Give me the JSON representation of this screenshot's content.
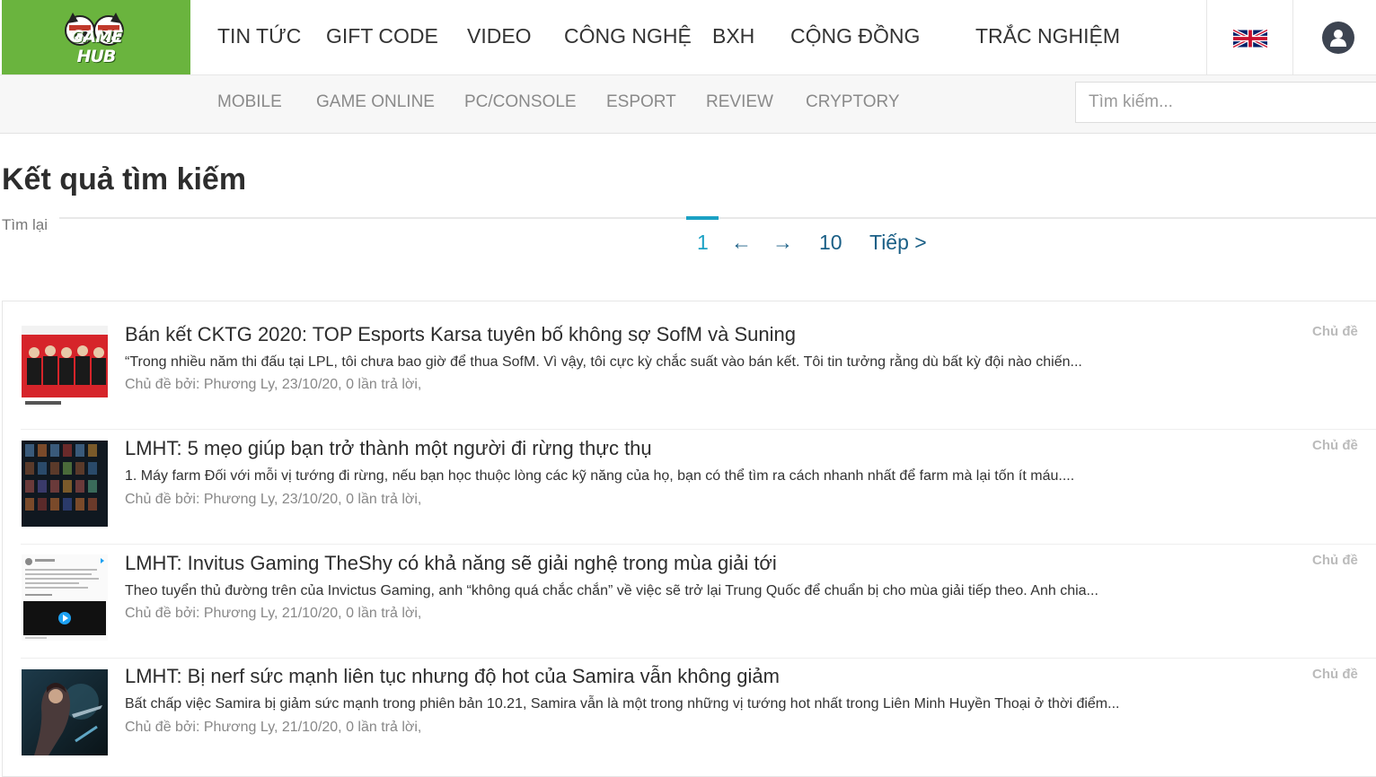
{
  "site": {
    "logo_text": "GAME HUB",
    "main_nav": [
      "TIN TỨC",
      "GIFT CODE",
      "VIDEO",
      "CÔNG NGHỆ",
      "BXH",
      "CỘNG ĐỒNG",
      "TRẮC NGHIỆM"
    ],
    "sub_nav": [
      "MOBILE",
      "GAME ONLINE",
      "PC/CONSOLE",
      "ESPORT",
      "REVIEW",
      "CRYPTORY"
    ],
    "search_placeholder": "Tìm kiếm...",
    "language_icon": "uk-flag-icon",
    "user_icon": "user-icon",
    "brand_color": "#6ab43e",
    "accent_color": "#1ba1c4"
  },
  "page": {
    "title": "Kết quả tìm kiếm",
    "retry_link": "Tìm lại"
  },
  "pagination": {
    "current": "1",
    "prev": "←",
    "next": "→",
    "last": "10",
    "next_label": "Tiếp >"
  },
  "results": [
    {
      "title": "Bán kết CKTG 2020: TOP Esports Karsa tuyên bố không sợ SofM và Suning",
      "snippet": "“Trong nhiều năm thi đấu tại LPL, tôi chưa bao giờ để thua SofM. Vì vậy, tôi cực kỳ chắc suất vào bán kết. Tôi tin tưởng rằng dù bất kỳ đội nào chiến...",
      "meta": "Chủ đề bởi: Phương Ly, 23/10/20, 0 lần trả lời,",
      "type": "Chủ đề"
    },
    {
      "title": "LMHT: 5 mẹo giúp bạn trở thành một người đi rừng thực thụ",
      "snippet": "1. Máy farm Đối với mỗi vị tướng đi rừng, nếu bạn học thuộc lòng các kỹ năng của họ, bạn có thể tìm ra cách nhanh nhất để farm mà lại tốn ít máu....",
      "meta": "Chủ đề bởi: Phương Ly, 23/10/20, 0 lần trả lời,",
      "type": "Chủ đề"
    },
    {
      "title": "LMHT: Invitus Gaming TheShy có khả năng sẽ giải nghệ trong mùa giải tới",
      "snippet": "Theo tuyển thủ đường trên của Invictus Gaming, anh “không quá chắc chắn” về việc sẽ trở lại Trung Quốc để chuẩn bị cho mùa giải tiếp theo. Anh chia...",
      "meta": "Chủ đề bởi: Phương Ly, 21/10/20, 0 lần trả lời,",
      "type": "Chủ đề"
    },
    {
      "title": "LMHT: Bị nerf sức mạnh liên tục nhưng độ hot của Samira vẫn không giảm",
      "snippet": "Bất chấp việc Samira bị giảm sức mạnh trong phiên bản 10.21, Samira vẫn là một trong những vị tướng hot nhất trong Liên Minh Huyền Thoại ở thời điểm...",
      "meta": "Chủ đề bởi: Phương Ly, 21/10/20, 0 lần trả lời,",
      "type": "Chủ đề"
    }
  ]
}
